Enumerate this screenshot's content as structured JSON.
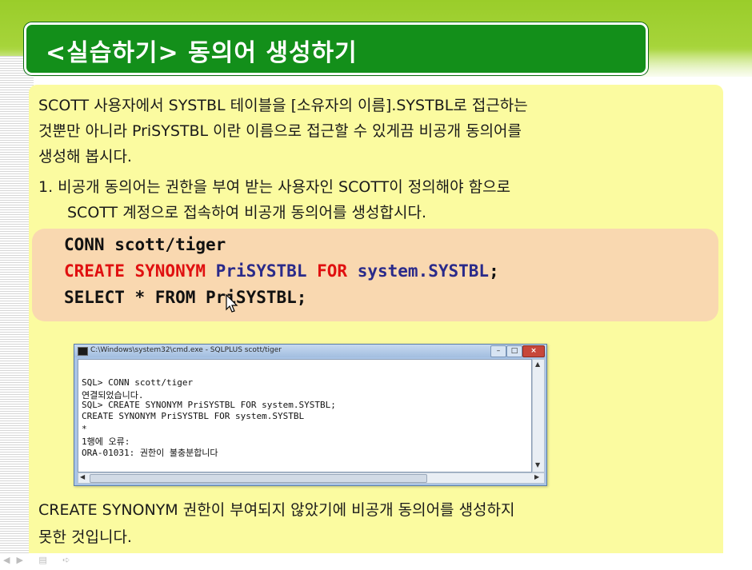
{
  "title": "<실습하기> 동의어 생성하기",
  "intro_lines": [
    "SCOTT 사용자에서 SYSTBL 테이블을 [소유자의 이름].SYSTBL로 접근하는",
    " 것뿐만 아니라 PriSYSTBL  이란 이름으로 접근할 수 있게끔 비공개 동의어를",
    "생성해 봅시다."
  ],
  "step1_lines": [
    "1.  비공개 동의어는 권한을 부여 받는 사용자인 SCOTT이 정의해야 함으로",
    "SCOTT 계정으로 접속하여 비공개 동의어를 생성합시다."
  ],
  "code": {
    "line1": "CONN scott/tiger",
    "line2_kw": "CREATE SYNONYM",
    "line2_name": "PriSYSTBL",
    "line2_for": "FOR",
    "line2_target": "system.SYSTBL",
    "line2_end": ";",
    "line3": "SELECT * FROM PriSYSTBL;"
  },
  "console": {
    "window_title": "C:\\Windows\\system32\\cmd.exe - SQLPLUS  scott/tiger",
    "lines": [
      "SQL> CONN scott/tiger",
      "연결되었습니다.",
      "SQL> CREATE SYNONYM PriSYSTBL FOR system.SYSTBL;",
      "CREATE SYNONYM PriSYSTBL FOR system.SYSTBL",
      "*",
      "1행에 오류:",
      "ORA-01031: 권한이 불충분합니다"
    ]
  },
  "conclusion_lines": [
    "CREATE SYNONYM 권한이 부여되지 않았기에 비공개 동의어를 생성하지",
    "못한 것입니다."
  ],
  "colors": {
    "title_green": "#138f1a",
    "panel_yellow": "#fbfba0",
    "code_bg": "#f9d8b0",
    "keyword_red": "#e01010",
    "identifier_blue": "#2a2a8a"
  }
}
